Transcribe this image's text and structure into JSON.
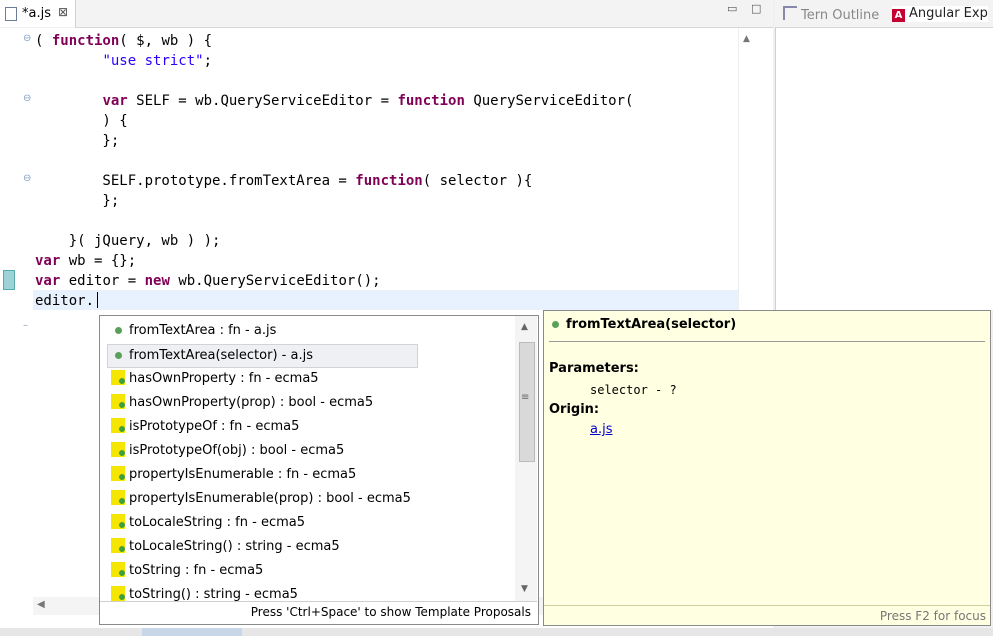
{
  "editor": {
    "tab_label": "*a.js",
    "tab_close": "⊠",
    "code_lines": [
      "( function( $, wb ) {",
      "        \"use strict\";",
      "",
      "        var SELF = wb.QueryServiceEditor = function QueryServiceEditor(",
      "        ) {",
      "        };",
      "",
      "        SELF.prototype.fromTextArea = function( selector ){",
      "        };",
      "",
      "    }( jQuery, wb ) );",
      "var wb = {};",
      "var editor = new wb.QueryServiceEditor();",
      "editor."
    ]
  },
  "views": {
    "tern_outline": "Tern Outline",
    "angular_explorer": "Angular Exp"
  },
  "proposals": {
    "items": [
      {
        "label": "fromTextArea : fn - a.js",
        "icon": "field-dot"
      },
      {
        "label": "fromTextArea(selector) - a.js",
        "icon": "field-dot"
      },
      {
        "label": "hasOwnProperty : fn - ecma5",
        "icon": "function-icon"
      },
      {
        "label": "hasOwnProperty(prop) : bool - ecma5",
        "icon": "function-icon"
      },
      {
        "label": "isPrototypeOf : fn - ecma5",
        "icon": "function-icon"
      },
      {
        "label": "isPrototypeOf(obj) : bool - ecma5",
        "icon": "function-icon"
      },
      {
        "label": "propertyIsEnumerable : fn - ecma5",
        "icon": "function-icon"
      },
      {
        "label": "propertyIsEnumerable(prop) : bool - ecma5",
        "icon": "function-icon"
      },
      {
        "label": "toLocaleString : fn - ecma5",
        "icon": "function-icon"
      },
      {
        "label": "toLocaleString() : string - ecma5",
        "icon": "function-icon"
      },
      {
        "label": "toString : fn - ecma5",
        "icon": "function-icon"
      },
      {
        "label": "toString() : string - ecma5",
        "icon": "function-icon"
      }
    ],
    "selected_index": 1,
    "footer": "Press 'Ctrl+Space' to show Template Proposals"
  },
  "info": {
    "title": "fromTextArea(selector)",
    "params_heading": "Parameters:",
    "param": "selector - ?",
    "origin_heading": "Origin:",
    "origin_link": "a.js",
    "footer": "Press F2 for focus"
  }
}
